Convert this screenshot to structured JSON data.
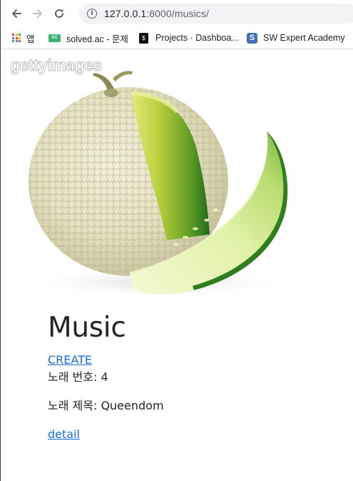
{
  "browser": {
    "url_host": "127.0.0.1",
    "url_rest": ":8000/musics/",
    "bookmarks": [
      {
        "label": "앱",
        "icon": "apps-grid-icon"
      },
      {
        "label": "solved.ac - 문제",
        "icon": "solved-ac-icon"
      },
      {
        "label": "Projects · Dashboa...",
        "icon": "projects-icon"
      },
      {
        "label": "SW Expert Academy",
        "icon": "sw-expert-academy-icon"
      }
    ]
  },
  "hero": {
    "alt": "melon",
    "watermark": "gettyimages"
  },
  "page": {
    "title": "Music",
    "create_label": "CREATE",
    "items": [
      {
        "number_label": "노래 번호: 4",
        "title_label": "노래 제목: Queendom",
        "detail_label": "detail"
      }
    ]
  },
  "colors": {
    "link": "#1a6ed8",
    "text": "#212529",
    "omnibox": "#f1f3f4"
  }
}
